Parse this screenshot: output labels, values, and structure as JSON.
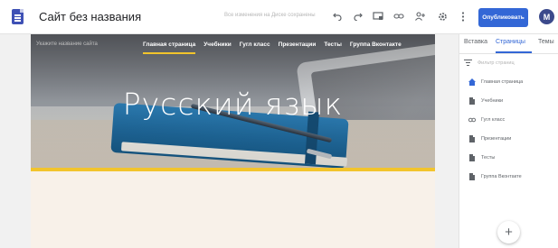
{
  "app": {
    "title": "Сайт без названия",
    "saved_status": "Все изменения на Диске сохранены",
    "publish_label": "Опубликовать",
    "avatar_letter": "М",
    "toolbar_icons": [
      "undo-icon",
      "redo-icon",
      "preview-icon",
      "link-icon",
      "share-icon",
      "settings-icon",
      "more-vert-icon"
    ]
  },
  "site": {
    "name_placeholder": "Укажите название сайта",
    "nav": [
      {
        "label": "Главная страница",
        "active": true
      },
      {
        "label": "Учебники",
        "active": false
      },
      {
        "label": "Гугл класс",
        "active": false
      },
      {
        "label": "Презентации",
        "active": false
      },
      {
        "label": "Тесты",
        "active": false
      },
      {
        "label": "Группа Вконтакте",
        "active": false
      }
    ],
    "banner_title": "Русский язык",
    "accent_color": "#f2c42c"
  },
  "sidebar": {
    "tabs": [
      {
        "label": "Вставка",
        "active": false
      },
      {
        "label": "Страницы",
        "active": true
      },
      {
        "label": "Темы",
        "active": false
      }
    ],
    "filter_placeholder": "Фильтр страниц",
    "pages": [
      {
        "label": "Главная страница",
        "icon": "home-icon"
      },
      {
        "label": "Учебники",
        "icon": "page-icon"
      },
      {
        "label": "Гугл класс",
        "icon": "link-icon"
      },
      {
        "label": "Презентации",
        "icon": "page-icon"
      },
      {
        "label": "Тесты",
        "icon": "page-icon"
      },
      {
        "label": "Группа Вконтакте",
        "icon": "page-icon"
      }
    ],
    "add_label": "+"
  },
  "colors": {
    "brand_blue": "#3367d6",
    "doc_icon": "#3f51b5"
  }
}
